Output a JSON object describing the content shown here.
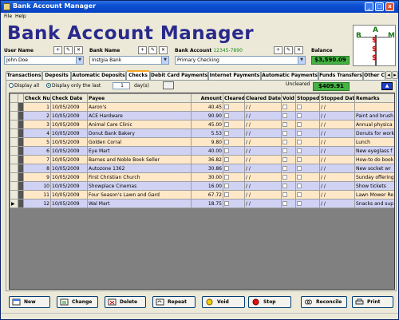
{
  "window": {
    "title": "Bank Account Manager",
    "buttons": [
      "_",
      "□",
      "x"
    ]
  },
  "menu": [
    "File",
    "Help"
  ],
  "header": {
    "app_title": "Bank Account Manager",
    "user_label": "User Name",
    "user_value": "John Doe",
    "bank_label": "Bank Name",
    "bank_value": "Instgia Bank",
    "account_label": "Bank Account",
    "account_number": "12345-7890",
    "account_value": "Primary Checking",
    "balance_label": "Balance",
    "balance_value": "$3,590.09",
    "logo_letters": [
      "B",
      "A",
      "M"
    ]
  },
  "tabs": [
    {
      "label": "Transactions",
      "active": false
    },
    {
      "label": "Deposits",
      "active": false
    },
    {
      "label": "Automatic Deposits",
      "active": false
    },
    {
      "label": "Checks",
      "active": true
    },
    {
      "label": "Debit Card Payments",
      "active": false
    },
    {
      "label": "Internet Payments",
      "active": false
    },
    {
      "label": "Automatic Payments",
      "active": false
    },
    {
      "label": "Funds Transfers",
      "active": false
    },
    {
      "label": "Other C",
      "active": false
    }
  ],
  "filters": {
    "display_all": "Display all",
    "display_last": "Display only the last",
    "days_value": "1",
    "days_label": "day(s)",
    "uncleared_label": "Uncleared",
    "uncleared_value": "$409.91"
  },
  "grid": {
    "columns": [
      "",
      "Check Num",
      "Check Date",
      "Payee",
      "Amount",
      "Cleared",
      "Cleared Date",
      "Void",
      "Stopped",
      "Stopped Date",
      "Remarks"
    ],
    "rows": [
      {
        "num": "1",
        "date": "10/05/2009",
        "payee": "Aaron's",
        "amount": "40.45",
        "cdate": "/ /",
        "sdate": "/ /",
        "remarks": ""
      },
      {
        "num": "2",
        "date": "10/05/2009",
        "payee": "ACE Hardware",
        "amount": "90.90",
        "cdate": "/ /",
        "sdate": "/ /",
        "remarks": "Paint and brush"
      },
      {
        "num": "3",
        "date": "10/05/2009",
        "payee": "Animal Care Clinic",
        "amount": "45.00",
        "cdate": "/ /",
        "sdate": "/ /",
        "remarks": "Annual physica"
      },
      {
        "num": "4",
        "date": "10/05/2009",
        "payee": "Donut Bank Bakery",
        "amount": "5.53",
        "cdate": "/ /",
        "sdate": "/ /",
        "remarks": "Donuts for work"
      },
      {
        "num": "5",
        "date": "10/05/2009",
        "payee": "Golden Corral",
        "amount": "9.80",
        "cdate": "/ /",
        "sdate": "/ /",
        "remarks": "Lunch"
      },
      {
        "num": "6",
        "date": "10/05/2009",
        "payee": "Eye Mart",
        "amount": "40.00",
        "cdate": "/ /",
        "sdate": "/ /",
        "remarks": "New eyeglass f"
      },
      {
        "num": "7",
        "date": "10/05/2009",
        "payee": "Barnes and Noble Book Seller",
        "amount": "36.82",
        "cdate": "/ /",
        "sdate": "/ /",
        "remarks": "How-to do book"
      },
      {
        "num": "8",
        "date": "10/05/2009",
        "payee": "Autozone 1362",
        "amount": "30.86",
        "cdate": "/ /",
        "sdate": "/ /",
        "remarks": "New socket wr"
      },
      {
        "num": "9",
        "date": "10/05/2009",
        "payee": "First Christian Church",
        "amount": "30.00",
        "cdate": "/ /",
        "sdate": "/ /",
        "remarks": "Sunday offering"
      },
      {
        "num": "10",
        "date": "10/05/2009",
        "payee": "Showplace Cinemas",
        "amount": "16.00",
        "cdate": "/ /",
        "sdate": "/ /",
        "remarks": "Show tickets"
      },
      {
        "num": "11",
        "date": "10/05/2009",
        "payee": "Four Season's Lawn and Gard",
        "amount": "67.72",
        "cdate": "/ /",
        "sdate": "/ /",
        "remarks": "Lawn Mower Re"
      },
      {
        "num": "12",
        "date": "10/05/2009",
        "payee": "Wal Mart",
        "amount": "18.75",
        "cdate": "/ /",
        "sdate": "/ /",
        "remarks": "Snacks and sup"
      }
    ]
  },
  "buttons": {
    "new": "New",
    "change": "Change",
    "delete": "Delete",
    "repeat": "Repeat",
    "void": "Void",
    "stop": "Stop",
    "reconcile": "Reconcile",
    "print": "Print"
  },
  "colors": {
    "row_alt_a": "#ffe8c8",
    "row_alt_b": "#d0d2f4",
    "balance": "#44b244",
    "title": "#2a2a8c"
  }
}
